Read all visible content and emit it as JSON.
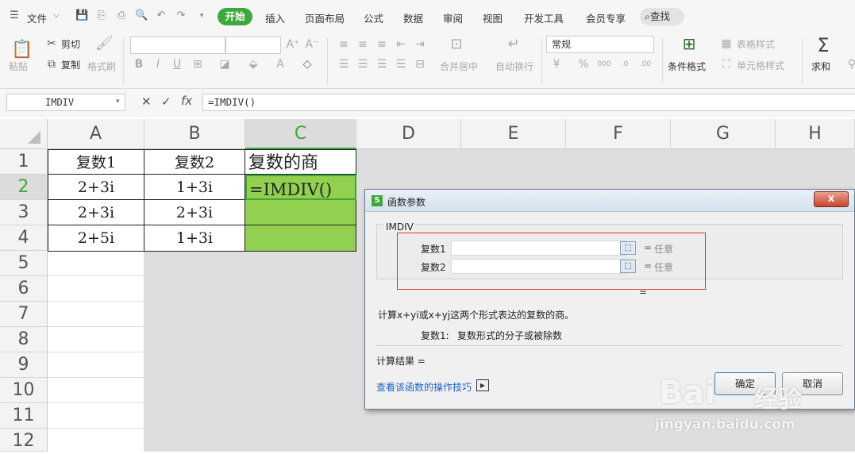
{
  "menu": {
    "file": "文件",
    "tabs": [
      "开始",
      "插入",
      "页面布局",
      "公式",
      "数据",
      "审阅",
      "视图",
      "开发工具",
      "会员专享"
    ],
    "search": "查找"
  },
  "ribbon": {
    "paste": "粘贴",
    "cut": "剪切",
    "copy": "复制",
    "format_painter": "格式刷",
    "merge_center": "合并居中",
    "wrap_text": "自动换行",
    "number_format": "常规",
    "cond_format": "条件格式",
    "table_style": "表格样式",
    "cell_style": "单元格样式",
    "sum": "求和"
  },
  "formula_bar": {
    "name_box": "IMDIV",
    "formula": "=IMDIV()"
  },
  "columns": [
    "A",
    "B",
    "C",
    "D",
    "E",
    "F",
    "G",
    "H"
  ],
  "rows": [
    "1",
    "2",
    "3",
    "4",
    "5",
    "6",
    "7",
    "8",
    "9",
    "10",
    "11",
    "12"
  ],
  "cells": {
    "A1": "复数1",
    "B1": "复数2",
    "C1": "复数的商",
    "A2": "2+3i",
    "B2": "1+3i",
    "C2": "=IMDIV()",
    "A3": "2+3i",
    "B3": "2+3i",
    "A4": "2+5i",
    "B4": "1+3i"
  },
  "dialog": {
    "title": "函数参数",
    "close": "x",
    "func_name": "IMDIV",
    "args": [
      {
        "label": "复数1",
        "value": "",
        "result": "任意"
      },
      {
        "label": "复数2",
        "value": "",
        "result": "任意"
      }
    ],
    "eq": "=",
    "result_eq": "=",
    "description": "计算x+yi或x+yj这两个形式表达的复数的商。",
    "arg_help_label": "复数1:",
    "arg_help_text": "复数形式的分子或被除数",
    "calc_result": "计算结果  =",
    "tips_link": "查看该函数的操作技巧",
    "ok": "确定",
    "cancel": "取消"
  },
  "watermark": {
    "brand_left": "Bai",
    "brand_right": "经验",
    "url": "jingyan.baidu.com"
  },
  "colors": {
    "accent_green": "#3ea83a",
    "selection_green": "#92d050",
    "highlight_red": "#e03030"
  }
}
